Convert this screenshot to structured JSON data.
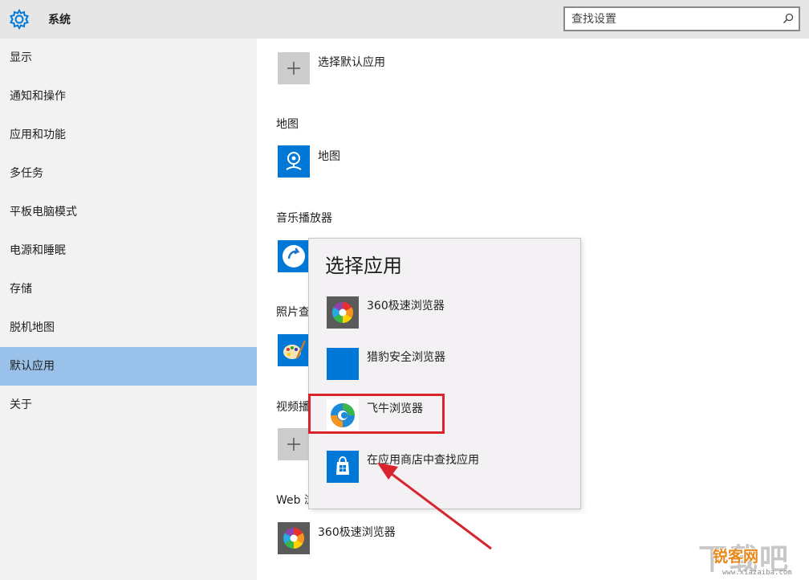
{
  "header": {
    "title": "系统",
    "search_placeholder": "查找设置"
  },
  "sidebar": {
    "items": [
      {
        "label": "显示"
      },
      {
        "label": "通知和操作"
      },
      {
        "label": "应用和功能"
      },
      {
        "label": "多任务"
      },
      {
        "label": "平板电脑模式"
      },
      {
        "label": "电源和睡眠"
      },
      {
        "label": "存储"
      },
      {
        "label": "脱机地图"
      },
      {
        "label": "默认应用",
        "active": true
      },
      {
        "label": "关于"
      }
    ]
  },
  "main": {
    "choose_default_label": "选择默认应用",
    "maps": {
      "heading": "地图",
      "app": "地图"
    },
    "music": {
      "heading": "音乐播放器"
    },
    "photo": {
      "heading_visible": "照片查"
    },
    "video": {
      "heading_visible": "视频播"
    },
    "web": {
      "heading_visible": "Web 浏",
      "app": "360极速浏览器"
    }
  },
  "popup": {
    "title": "选择应用",
    "items": [
      {
        "label": "360极速浏览器",
        "icon": "360-browser-icon"
      },
      {
        "label": "猎豹安全浏览器",
        "icon": "liebao-browser-icon"
      },
      {
        "label": "飞牛浏览器",
        "icon": "feiniu-browser-icon",
        "highlighted": true
      },
      {
        "label": "在应用商店中查找应用",
        "icon": "store-icon"
      }
    ]
  },
  "watermark": {
    "big": "下载吧",
    "text": "锐客网",
    "url": "www.xiazaiba.com"
  },
  "colors": {
    "header_bg": "#e6e6e6",
    "sidebar_bg": "#f2f2f2",
    "active_item": "#99c1ea",
    "tile_blue": "#0078d7",
    "highlight_red": "#d9232d"
  }
}
